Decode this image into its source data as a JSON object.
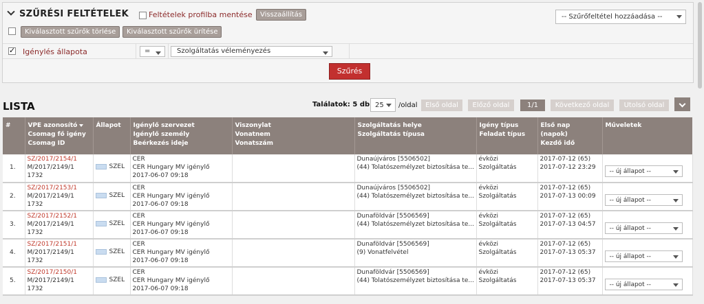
{
  "filter": {
    "title": "SZŰRÉSI FELTÉTELEK",
    "save_profile": "Feltételek profilba mentése",
    "reset": "Visszaállítás",
    "clear_selected": "Kiválasztott szűrők törlése",
    "empty_selected": "Kiválasztott szűrők ürítése",
    "add_filter": "-- Szűrőfeltétel hozzáadása --",
    "row_label": "Igénylés állapota",
    "operator": "=",
    "value": "Szolgáltatás véleményezés",
    "submit": "Szűrés"
  },
  "list": {
    "title": "LISTA",
    "results": "Találatok: 5 db.",
    "per_page_value": "25",
    "per_page_label": "/oldal",
    "pager": {
      "first": "Első oldal",
      "prev": "Előző oldal",
      "current": "1/1",
      "next": "Következő oldal",
      "last": "Utolsó oldal"
    }
  },
  "table": {
    "headers": [
      [
        "#"
      ],
      [
        "VPE azonosító",
        "Csomag fő igény",
        "Csomag ID"
      ],
      [
        "Állapot"
      ],
      [
        "Igénylő szervezet",
        "Igénylő személy",
        "Beérkezés ideje"
      ],
      [
        "Viszonylat",
        "Vonatnem",
        "Vonatszám"
      ],
      [
        "Szolgáltatás helye",
        "Szolgáltatás típusa"
      ],
      [
        "Igény típus",
        "Feladat típus"
      ],
      [
        "Első nap (napok)",
        "Kezdő idő"
      ],
      [
        "Műveletek"
      ]
    ],
    "rows": [
      {
        "num": "1.",
        "id": "SZ/2017/2154/1",
        "main": "M/2017/2149/1",
        "pkg": "1732",
        "state": "SZEL",
        "org": "CER",
        "person": "CER Hungary MV igénylő",
        "received": "2017-06-07 09:18",
        "place": "Dunaújváros [5506502]",
        "type": "(44) Tolatószemélyzet biztosítása te...",
        "req": "évközi",
        "task": "Szolgáltatás",
        "first": "2017-07-12 (65)",
        "start": "2017-07-12 23:29",
        "op": "-- új állapot --"
      },
      {
        "num": "2.",
        "id": "SZ/2017/2153/1",
        "main": "M/2017/2149/1",
        "pkg": "1732",
        "state": "SZEL",
        "org": "CER",
        "person": "CER Hungary MV igénylő",
        "received": "2017-06-07 09:18",
        "place": "Dunaújváros [5506502]",
        "type": "(44) Tolatószemélyzet biztosítása te...",
        "req": "évközi",
        "task": "Szolgáltatás",
        "first": "2017-07-12 (65)",
        "start": "2017-07-13 00:09",
        "op": "-- új állapot --"
      },
      {
        "num": "3.",
        "id": "SZ/2017/2152/1",
        "main": "M/2017/2149/1",
        "pkg": "1732",
        "state": "SZEL",
        "org": "CER",
        "person": "CER Hungary MV igénylő",
        "received": "2017-06-07 09:18",
        "place": "Dunaföldvár [5506569]",
        "type": "(44) Tolatószemélyzet biztosítása te...",
        "req": "évközi",
        "task": "Szolgáltatás",
        "first": "2017-07-12 (65)",
        "start": "2017-07-13 04:57",
        "op": "-- új állapot --"
      },
      {
        "num": "4.",
        "id": "SZ/2017/2151/1",
        "main": "M/2017/2149/1",
        "pkg": "1732",
        "state": "SZEL",
        "org": "CER",
        "person": "CER Hungary MV igénylő",
        "received": "2017-06-07 09:18",
        "place": "Dunaföldvár [5506569]",
        "type": "(9) Vonatfelvétel",
        "req": "évközi",
        "task": "Szolgáltatás",
        "first": "2017-07-12 (65)",
        "start": "2017-07-13 05:37",
        "op": "-- új állapot --"
      },
      {
        "num": "5.",
        "id": "SZ/2017/2150/1",
        "main": "M/2017/2149/1",
        "pkg": "1732",
        "state": "SZEL",
        "org": "CER",
        "person": "CER Hungary MV igénylő",
        "received": "2017-06-07 09:18",
        "place": "Dunaföldvár [5506569]",
        "type": "(44) Tolatószemélyzet biztosítása te...",
        "req": "évközi",
        "task": "Szolgáltatás",
        "first": "2017-07-12 (65)",
        "start": "2017-07-13 05:37",
        "op": "-- új állapot --"
      }
    ]
  }
}
